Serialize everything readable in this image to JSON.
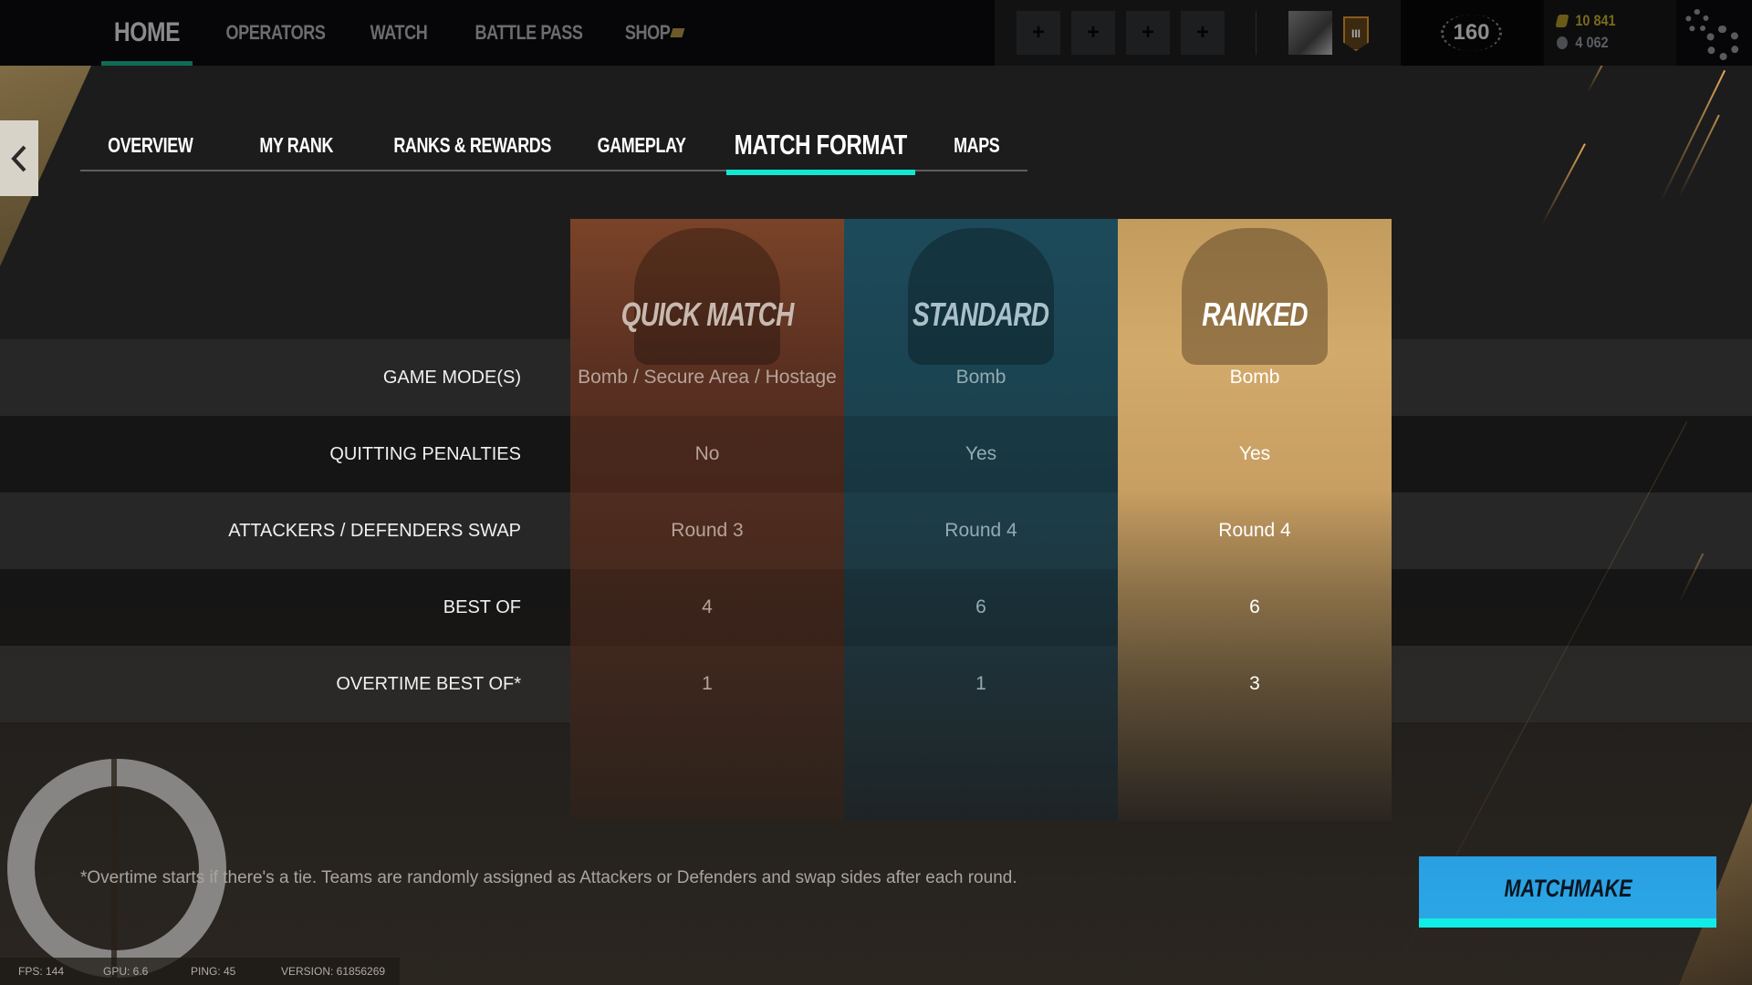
{
  "top_nav": {
    "items": [
      {
        "label": "HOME",
        "active": true
      },
      {
        "label": "OPERATORS",
        "active": false
      },
      {
        "label": "WATCH",
        "active": false
      },
      {
        "label": "BATTLE PASS",
        "active": false
      },
      {
        "label": "SHOP",
        "active": false
      }
    ],
    "accent_color": "#0f6b55"
  },
  "squad": {
    "invite_slots": [
      "+",
      "+",
      "+",
      "+"
    ],
    "rank_badge": "III"
  },
  "player": {
    "level": "160",
    "r6_credits": "10 841",
    "renown": "4 062"
  },
  "sub_tabs": {
    "items": [
      {
        "label": "OVERVIEW",
        "active": false
      },
      {
        "label": "MY RANK",
        "active": false
      },
      {
        "label": "RANKS & REWARDS",
        "active": false
      },
      {
        "label": "GAMEPLAY",
        "active": false
      },
      {
        "label": "MATCH FORMAT",
        "active": true
      },
      {
        "label": "MAPS",
        "active": false
      }
    ],
    "active_color": "#10e8d4"
  },
  "match_format": {
    "columns": [
      {
        "title": "QUICK MATCH",
        "color": "#7a4328"
      },
      {
        "title": "STANDARD",
        "color": "#1d4a5a"
      },
      {
        "title": "RANKED",
        "color": "#d2aa6a"
      }
    ],
    "rows": [
      {
        "label": "GAME MODE(S)",
        "values": [
          "Bomb / Secure Area / Hostage",
          "Bomb",
          "Bomb"
        ]
      },
      {
        "label": "QUITTING PENALTIES",
        "values": [
          "No",
          "Yes",
          "Yes"
        ]
      },
      {
        "label": "ATTACKERS / DEFENDERS SWAP",
        "values": [
          "Round 3",
          "Round 4",
          "Round 4"
        ]
      },
      {
        "label": "BEST OF",
        "values": [
          "4",
          "6",
          "6"
        ]
      },
      {
        "label": "OVERTIME BEST OF*",
        "values": [
          "1",
          "1",
          "3"
        ]
      }
    ],
    "footnote": "*Overtime starts if there's a tie. Teams are randomly assigned as Attackers or Defenders and swap sides after each round."
  },
  "actions": {
    "matchmake_label": "MATCHMAKE",
    "matchmake_color": "#2aa8e6"
  },
  "status_bar": {
    "fps": "FPS: 144",
    "gpu": "GPU: 6.6",
    "ping": "PING: 45",
    "version": "VERSION: 61856269"
  }
}
